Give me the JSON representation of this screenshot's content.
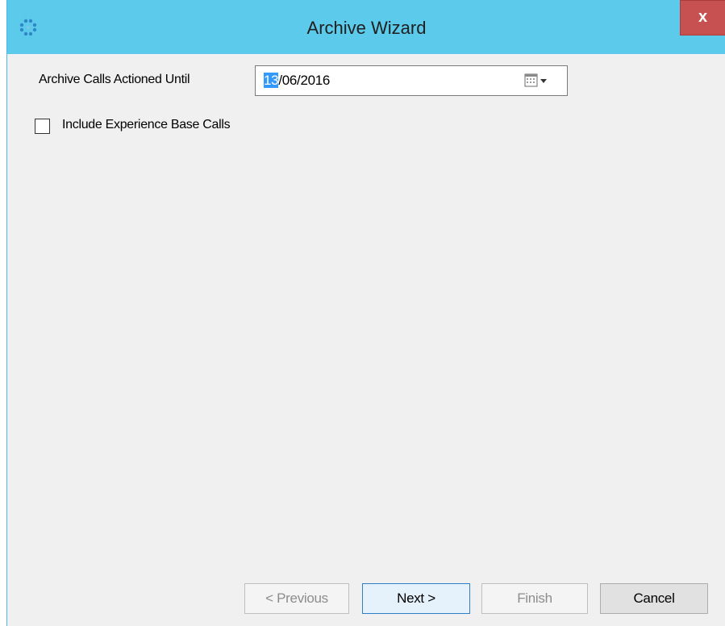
{
  "window": {
    "title": "Archive Wizard",
    "close_label": "x",
    "app_icon": "dots-cluster-icon"
  },
  "form": {
    "archive_label": "Archive Calls Actioned Until",
    "date_value_selected": "13",
    "date_value_rest": "/06/2016",
    "calendar_icon": "calendar-dropdown-icon",
    "checkbox_label": "Include Experience Base Calls",
    "checkbox_checked": false
  },
  "buttons": {
    "previous_label": "< Previous",
    "next_label": "Next >",
    "finish_label": "Finish",
    "cancel_label": "Cancel"
  },
  "colors": {
    "titlebar": "#5ccaea",
    "close": "#c75050",
    "selection": "#3399ff",
    "default_button_border": "#2f7fc6"
  }
}
